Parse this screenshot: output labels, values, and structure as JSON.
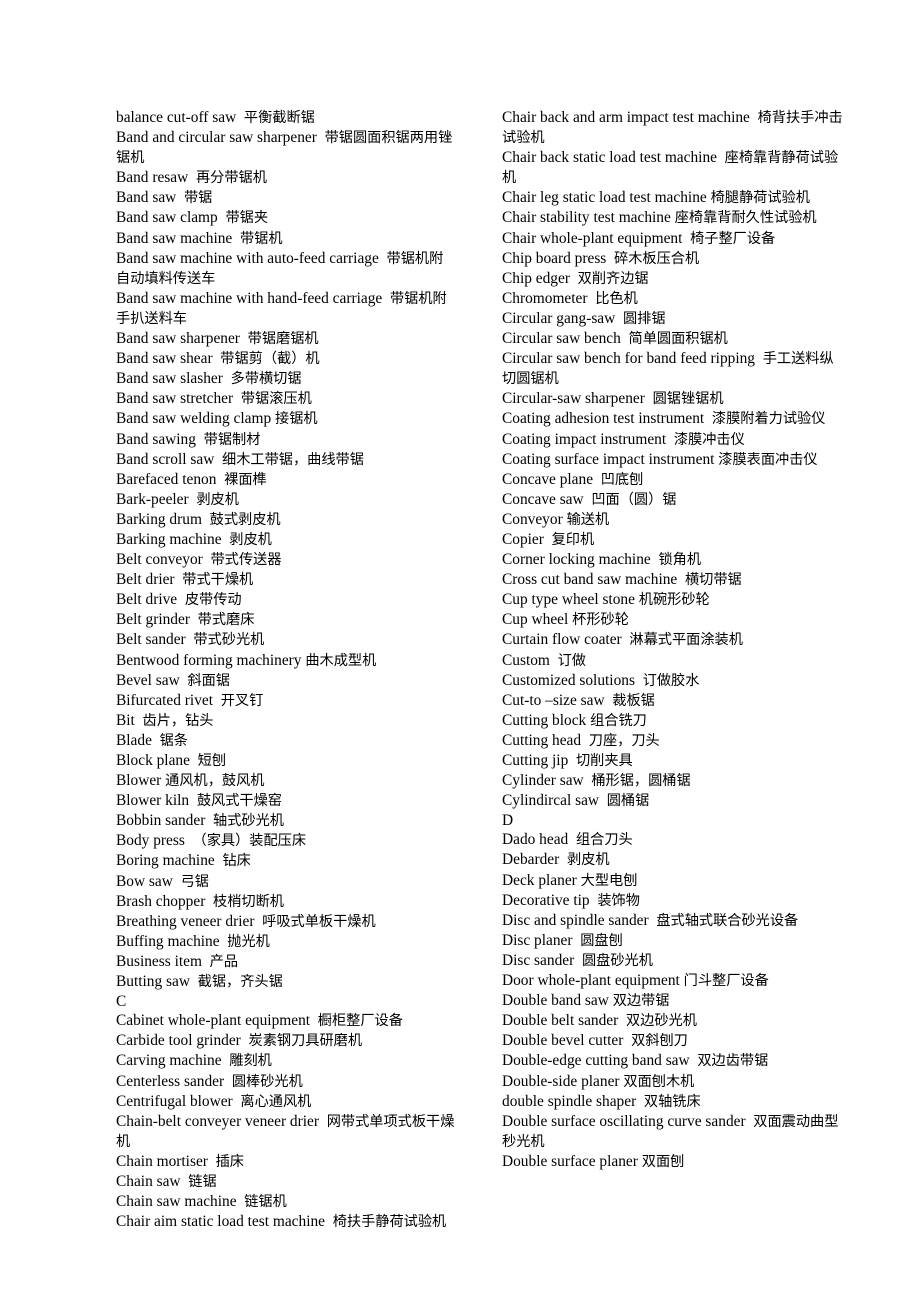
{
  "document": {
    "type": "bilingual-glossary",
    "language_pair": "English-Chinese",
    "columns": 2
  },
  "left_column": [
    {
      "en": "balance cut-off saw",
      "zh": "平衡截断锯"
    },
    {
      "en": "Band and circular saw sharpener",
      "zh": "带锯圆面积锯两用锉锯机"
    },
    {
      "en": "Band resaw",
      "zh": "再分带锯机"
    },
    {
      "en": "Band saw",
      "zh": "带锯"
    },
    {
      "en": "Band saw clamp",
      "zh": "带锯夹"
    },
    {
      "en": "Band saw machine",
      "zh": "带锯机"
    },
    {
      "en": "Band saw machine with auto-feed carriage",
      "zh": "带锯机附自动填料传送车"
    },
    {
      "en": "Band saw machine with hand-feed carriage",
      "zh": "带锯机附手扒送料车"
    },
    {
      "en": "Band saw sharpener",
      "zh": "带锯磨锯机"
    },
    {
      "en": "Band saw shear",
      "zh": "带锯剪（截）机"
    },
    {
      "en": "Band saw slasher",
      "zh": "多带横切锯"
    },
    {
      "en": "Band saw stretcher",
      "zh": "带锯滚压机"
    },
    {
      "en": "Band saw welding clamp",
      "zh": "接锯机",
      "nospace": true
    },
    {
      "en": "Band sawing",
      "zh": "带锯制材"
    },
    {
      "en": "Band scroll saw",
      "zh": "细木工带锯，曲线带锯"
    },
    {
      "en": "Barefaced tenon",
      "zh": "裸面榫"
    },
    {
      "en": "Bark-peeler",
      "zh": "剥皮机"
    },
    {
      "en": "Barking drum",
      "zh": "鼓式剥皮机"
    },
    {
      "en": "Barking machine",
      "zh": "剥皮机"
    },
    {
      "en": "Belt conveyor",
      "zh": "带式传送器"
    },
    {
      "en": "Belt drier",
      "zh": "带式干燥机"
    },
    {
      "en": "Belt drive",
      "zh": "皮带传动"
    },
    {
      "en": "Belt grinder",
      "zh": "带式磨床"
    },
    {
      "en": "Belt sander",
      "zh": "带式砂光机"
    },
    {
      "en": "Bentwood forming machinery",
      "zh": "曲木成型机",
      "nospace": true
    },
    {
      "en": "Bevel saw",
      "zh": "斜面锯"
    },
    {
      "en": "Bifurcated rivet",
      "zh": "开叉钉"
    },
    {
      "en": "Bit",
      "zh": "齿片，钻头"
    },
    {
      "en": "Blade",
      "zh": "锯条"
    },
    {
      "en": "Block plane",
      "zh": "短刨"
    },
    {
      "en": "Blower",
      "zh": "通风机，鼓风机",
      "nospace": true
    },
    {
      "en": "Blower kiln",
      "zh": "鼓风式干燥窑"
    },
    {
      "en": "Bobbin sander",
      "zh": "轴式砂光机"
    },
    {
      "en": "Body press",
      "zh": "（家具）装配压床"
    },
    {
      "en": "Boring machine",
      "zh": "钻床"
    },
    {
      "en": "Bow saw",
      "zh": "弓锯"
    },
    {
      "en": "Brash chopper",
      "zh": "枝梢切断机"
    },
    {
      "en": "Breathing veneer drier",
      "zh": "呼吸式单板干燥机"
    },
    {
      "en": "Buffing machine",
      "zh": "抛光机"
    },
    {
      "en": "Business item",
      "zh": "产品"
    },
    {
      "en": "Butting saw",
      "zh": "截锯，齐头锯"
    },
    {
      "en": "C",
      "zh": "",
      "heading": true
    },
    {
      "en": "Cabinet whole-plant equipment",
      "zh": "橱柜整厂设备"
    },
    {
      "en": "Carbide tool grinder",
      "zh": "炭素钢刀具研磨机"
    },
    {
      "en": "Carving machine",
      "zh": "雕刻机"
    },
    {
      "en": "Centerless sander",
      "zh": "圆棒砂光机"
    },
    {
      "en": "Centrifugal blower",
      "zh": "离心通风机"
    },
    {
      "en": "Chain-belt conveyer veneer drier",
      "zh": "网带式单项式板干燥机"
    },
    {
      "en": "Chain mortiser",
      "zh": "插床"
    },
    {
      "en": "Chain saw",
      "zh": "链锯"
    },
    {
      "en": "Chain saw machine",
      "zh": "链锯机"
    },
    {
      "en": "Chair aim static load test machine",
      "zh": "椅扶手静荷试验机"
    }
  ],
  "right_column": [
    {
      "en": "Chair back and arm impact test machine",
      "zh": "椅背扶手冲击试验机"
    },
    {
      "en": "Chair back static load test machine",
      "zh": "座椅靠背静荷试验机"
    },
    {
      "en": "Chair leg static load test machine",
      "zh": "椅腿静荷试验机",
      "nospace": true
    },
    {
      "en": "Chair stability test machine",
      "zh": "座椅靠背耐久性试验机",
      "nospace": true
    },
    {
      "en": "Chair whole-plant equipment",
      "zh": "椅子整厂设备"
    },
    {
      "en": "Chip board press",
      "zh": "碎木板压合机"
    },
    {
      "en": "Chip edger",
      "zh": "双削齐边锯"
    },
    {
      "en": "Chromometer",
      "zh": "比色机"
    },
    {
      "en": "Circular gang-saw",
      "zh": "圆排锯"
    },
    {
      "en": "Circular saw bench",
      "zh": "简单圆面积锯机"
    },
    {
      "en": "Circular saw bench for band feed ripping",
      "zh": "手工送料纵切圆锯机"
    },
    {
      "en": "Circular-saw sharpener",
      "zh": "圆锯锉锯机"
    },
    {
      "en": "Coating adhesion test instrument",
      "zh": "漆膜附着力试验仪"
    },
    {
      "en": "Coating impact instrument",
      "zh": "漆膜冲击仪"
    },
    {
      "en": "Coating surface impact instrument",
      "zh": "漆膜表面冲击仪",
      "nospace": true
    },
    {
      "en": "Concave plane",
      "zh": "凹底刨"
    },
    {
      "en": "Concave saw",
      "zh": "凹面（圆）锯"
    },
    {
      "en": "Conveyor",
      "zh": "输送机",
      "nospace": true
    },
    {
      "en": "Copier",
      "zh": "复印机"
    },
    {
      "en": "Corner locking machine",
      "zh": "锁角机"
    },
    {
      "en": "Cross cut band saw machine",
      "zh": "横切带锯"
    },
    {
      "en": "Cup type wheel stone",
      "zh": "机碗形砂轮",
      "nospace": true
    },
    {
      "en": "Cup wheel",
      "zh": "杯形砂轮",
      "nospace": true
    },
    {
      "en": "Curtain flow coater",
      "zh": "淋幕式平面涂装机"
    },
    {
      "en": "Custom",
      "zh": "订做"
    },
    {
      "en": "Customized solutions",
      "zh": "订做胶水"
    },
    {
      "en": "Cut-to –size saw",
      "zh": "裁板锯"
    },
    {
      "en": "Cutting block",
      "zh": "组合铣刀",
      "nospace": true
    },
    {
      "en": "Cutting head",
      "zh": "刀座，刀头"
    },
    {
      "en": "Cutting jip",
      "zh": "切削夹具"
    },
    {
      "en": "Cylinder saw",
      "zh": "桶形锯，圆桶锯"
    },
    {
      "en": "Cylindircal saw",
      "zh": "圆桶锯"
    },
    {
      "en": "D",
      "zh": "",
      "heading": true
    },
    {
      "en": "Dado head",
      "zh": "组合刀头"
    },
    {
      "en": "Debarder",
      "zh": "剥皮机"
    },
    {
      "en": "Deck planer",
      "zh": "大型电刨",
      "nospace": true
    },
    {
      "en": "Decorative tip",
      "zh": "装饰物"
    },
    {
      "en": "Disc and spindle sander",
      "zh": "盘式轴式联合砂光设备"
    },
    {
      "en": "Disc planer",
      "zh": "圆盘刨"
    },
    {
      "en": "Disc sander",
      "zh": "圆盘砂光机"
    },
    {
      "en": "Door whole-plant equipment",
      "zh": "门斗整厂设备",
      "nospace": true
    },
    {
      "en": "Double band saw",
      "zh": "双边带锯",
      "nospace": true
    },
    {
      "en": "Double belt sander",
      "zh": "双边砂光机"
    },
    {
      "en": "Double bevel cutter",
      "zh": "双斜刨刀"
    },
    {
      "en": "Double-edge cutting band saw",
      "zh": "双边齿带锯"
    },
    {
      "en": "Double-side planer",
      "zh": "双面刨木机",
      "nospace": true
    },
    {
      "en": "double spindle shaper",
      "zh": "双轴铣床"
    },
    {
      "en": "Double surface oscillating curve sander",
      "zh": "双面震动曲型秒光机"
    },
    {
      "en": "Double surface planer",
      "zh": "双面刨",
      "nospace": true
    }
  ]
}
